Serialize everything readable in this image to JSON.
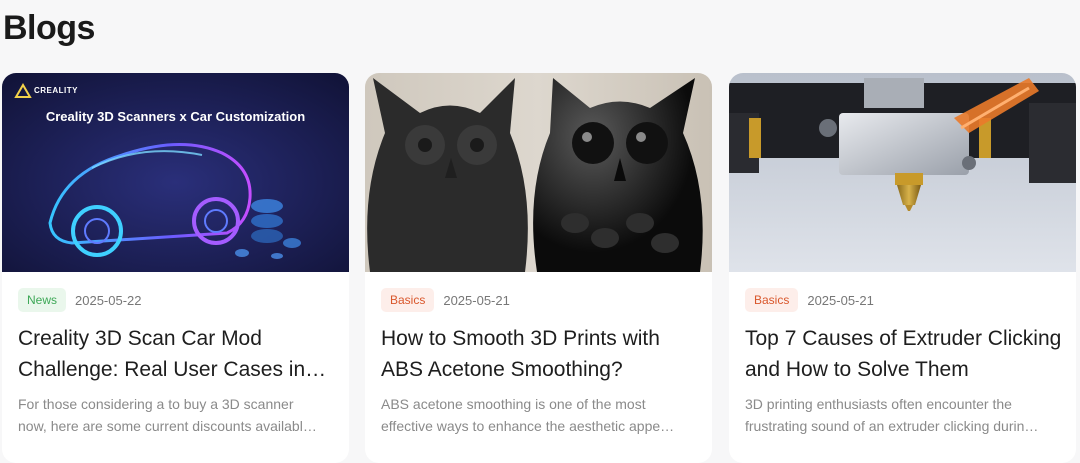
{
  "page": {
    "title": "Blogs"
  },
  "cards": [
    {
      "tag": "News",
      "tag_type": "news",
      "date": "2025-05-22",
      "title": "Creality 3D Scan Car Mod Challenge: Real User Cases in…",
      "excerpt_line1": "For those considering a to buy a 3D scanner",
      "excerpt_line2": "now, here are some current discounts availabl…",
      "image": {
        "brand": "CREALITY",
        "banner": "Creality 3D Scanners x Car Customization"
      }
    },
    {
      "tag": "Basics",
      "tag_type": "basics",
      "date": "2025-05-21",
      "title": "How to Smooth 3D Prints with ABS Acetone Smoothing?",
      "excerpt_line1": "ABS acetone smoothing is one of the most",
      "excerpt_line2": "effective ways to enhance the aesthetic appe…"
    },
    {
      "tag": "Basics",
      "tag_type": "basics",
      "date": "2025-05-21",
      "title": "Top 7 Causes of Extruder Clicking and How to Solve Them",
      "excerpt_line1": "3D printing enthusiasts often encounter the",
      "excerpt_line2": "frustrating sound of an extruder clicking durin…"
    }
  ],
  "colors": {
    "news_tag_bg": "#eaf7ec",
    "news_tag_fg": "#3ea857",
    "basics_tag_bg": "#fdeeea",
    "basics_tag_fg": "#d9572c",
    "banner_bg": "#1b1f4a"
  }
}
